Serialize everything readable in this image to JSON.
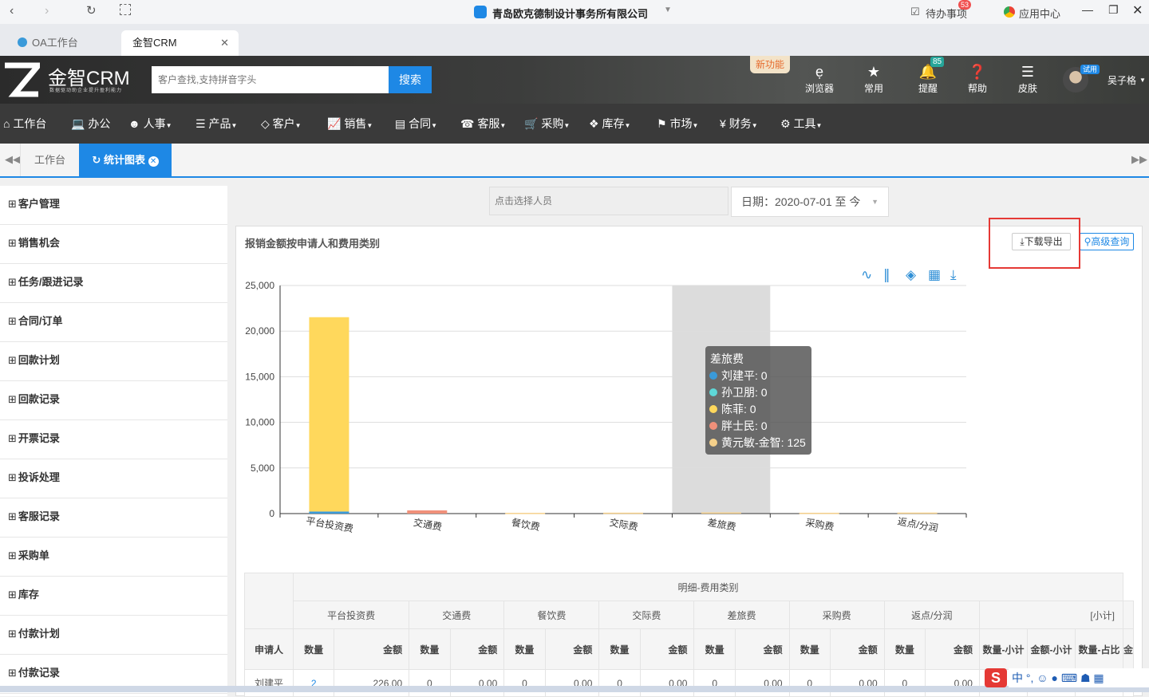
{
  "browser": {
    "page_title": "青岛欧克德制设计事务所有限公司",
    "todo_label": "待办事项",
    "todo_badge": "53",
    "app_center": "应用中心",
    "tabs": [
      {
        "label": "OA工作台"
      },
      {
        "label": "金智CRM"
      }
    ]
  },
  "crm": {
    "logo_text": "金智CRM",
    "logo_slogan": "数据驱动助企业提升盈利能力",
    "search_placeholder": "客户查找,支持拼音字头",
    "search_button": "搜索",
    "new_feature": "新功能",
    "header_icons": [
      {
        "label": "浏览器"
      },
      {
        "label": "常用"
      },
      {
        "label": "提醒",
        "badge": "85"
      },
      {
        "label": "帮助"
      },
      {
        "label": "皮肤"
      }
    ],
    "user": {
      "name": "吴子格",
      "tag": "试用"
    }
  },
  "nav": [
    "工作台",
    "办公",
    "人事",
    "产品",
    "客户",
    "销售",
    "合同",
    "客服",
    "采购",
    "库存",
    "市场",
    "财务",
    "工具"
  ],
  "page_tabs": [
    {
      "label": "工作台"
    },
    {
      "label": "统计图表"
    }
  ],
  "sidebar": [
    "客户管理",
    "销售机会",
    "任务/跟进记录",
    "合同/订单",
    "回款计划",
    "回款记录",
    "开票记录",
    "投诉处理",
    "客服记录",
    "采购单",
    "库存",
    "付款计划",
    "付款记录"
  ],
  "filters": {
    "person_placeholder": "点击选择人员",
    "date_range": "日期：2020-07-01 至 今"
  },
  "report": {
    "title": "报销金额按申请人和费用类别",
    "export_button": "下载导出",
    "advanced_search": "高级查询"
  },
  "chart_data": {
    "type": "bar",
    "stacked": true,
    "categories": [
      "平台投资费",
      "交通费",
      "餐饮费",
      "交际费",
      "差旅费",
      "采购费",
      "返点/分润"
    ],
    "ylim": [
      0,
      25000
    ],
    "yticks": [
      "0",
      "5,000",
      "10,000",
      "15,000",
      "20,000",
      "25,000"
    ],
    "grid": true,
    "highlight_category": "差旅费",
    "series": [
      {
        "name": "刘建平",
        "color": "#3a9ad9",
        "values": [
          226,
          0,
          0,
          0,
          0,
          0,
          0
        ]
      },
      {
        "name": "孙卫朋",
        "color": "#5ed7d7",
        "values": [
          0,
          0,
          0,
          0,
          0,
          0,
          0
        ]
      },
      {
        "name": "陈菲",
        "color": "#ffd85c",
        "values": [
          21300,
          0,
          0,
          0,
          0,
          0,
          0
        ]
      },
      {
        "name": "胖士民",
        "color": "#f0907a",
        "values": [
          0,
          350,
          0,
          0,
          0,
          0,
          0
        ]
      },
      {
        "name": "黄元敏-金智",
        "color": "#f5d08a",
        "values": [
          0,
          0,
          80,
          100,
          125,
          90,
          110
        ]
      }
    ],
    "tooltip": {
      "title": "差旅费",
      "rows": [
        {
          "label": "刘建平: 0",
          "color": "#3a9ad9"
        },
        {
          "label": "孙卫朋: 0",
          "color": "#5ed7d7"
        },
        {
          "label": "陈菲: 0",
          "color": "#ffd85c"
        },
        {
          "label": "胖士民: 0",
          "color": "#f0907a"
        },
        {
          "label": "黄元敏-金智: 125",
          "color": "#f5d08a"
        }
      ]
    }
  },
  "table": {
    "group_header": "明细-费用类别",
    "categories": [
      "平台投资费",
      "交通费",
      "餐饮费",
      "交际费",
      "差旅费",
      "采购费",
      "返点/分润",
      "[小计]"
    ],
    "applicant_header": "申请人",
    "qty": "数量",
    "amount": "金额",
    "subtotal_cols": [
      "数量-小计",
      "金额-小计",
      "数量-占比"
    ],
    "extra_col": "金",
    "rows": [
      {
        "name": "刘建平",
        "cells": [
          "2",
          "226.00",
          "0",
          "0.00",
          "0",
          "0.00",
          "0",
          "0.00",
          "0",
          "0.00",
          "0",
          "0.00",
          "0",
          "0.00"
        ]
      }
    ]
  },
  "taskbar": {
    "ime_label": "中"
  }
}
